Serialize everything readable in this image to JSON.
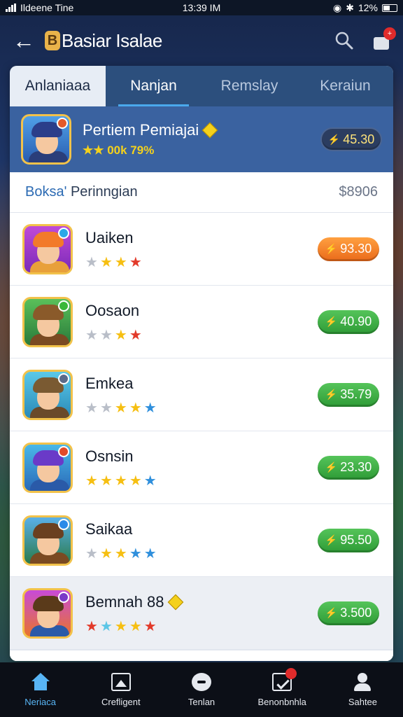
{
  "status_bar": {
    "carrier": "Ildeene Tine",
    "time": "13:39 IM",
    "battery": "12%"
  },
  "header": {
    "logo_letter": "B",
    "title": "Basiar Isalae"
  },
  "tabs": [
    {
      "label": "Anlaniaaa"
    },
    {
      "label": "Nanjan"
    },
    {
      "label": "Remslay"
    },
    {
      "label": "Keraiun"
    }
  ],
  "featured": {
    "name": "Pertiem Pemiajai",
    "meta": "★★ 00k 79%",
    "price": "45.30"
  },
  "section": {
    "title_accent": "Boksa'",
    "title_rest": " Perinngian",
    "amount": "$8906"
  },
  "rows": [
    {
      "name": "Uaiken",
      "price": "93.30",
      "pill": "orange"
    },
    {
      "name": "Oosaon",
      "price": "40.90",
      "pill": "green"
    },
    {
      "name": "Emkea",
      "price": "35.79",
      "pill": "green"
    },
    {
      "name": "Osnsin",
      "price": "23.30",
      "pill": "green"
    },
    {
      "name": "Saikaa",
      "price": "95.50",
      "pill": "green"
    },
    {
      "name": "Bemnah 88",
      "price": "3.500",
      "pill": "green"
    }
  ],
  "bottom_nav": [
    {
      "label": "Neriaca",
      "icon": "home-icon"
    },
    {
      "label": "Crefligent",
      "icon": "image-icon"
    },
    {
      "label": "Tenlan",
      "icon": "chat-icon"
    },
    {
      "label": "Benonbnhla",
      "icon": "box-icon"
    },
    {
      "label": "Sahtee",
      "icon": "user-icon"
    }
  ],
  "colors": {
    "accent": "#58b5f5",
    "pill_green": "#2e9b36",
    "pill_orange": "#ea6a1a",
    "header_bg": "#1e2f52",
    "featured_bg": "#3a62a0"
  }
}
